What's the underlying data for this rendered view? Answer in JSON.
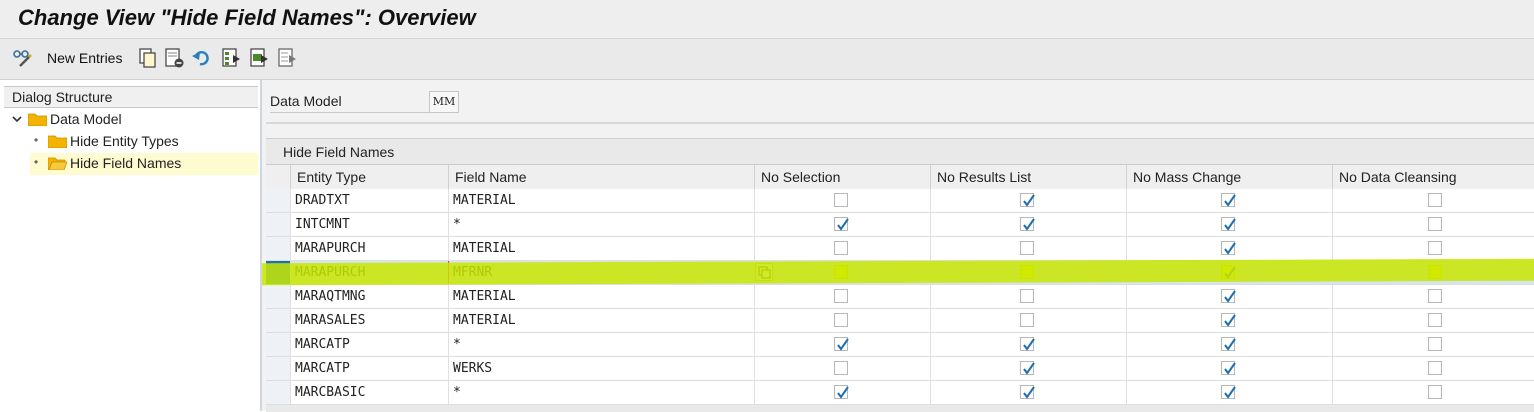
{
  "title": "Change View \"Hide Field Names\": Overview",
  "toolbar": {
    "new_entries_label": "New Entries",
    "icons": [
      "glasses-pencil-icon",
      "copy-icon",
      "delete-icon",
      "undo-icon",
      "select-all-icon",
      "select-block-icon",
      "deselect-all-icon"
    ]
  },
  "dialog": {
    "title": "Dialog Structure",
    "items": [
      {
        "label": "Data Model",
        "level": 0,
        "expanded": true
      },
      {
        "label": "Hide Entity Types",
        "level": 1
      },
      {
        "label": "Hide Field Names",
        "level": 1,
        "selected": true
      }
    ]
  },
  "header_field": {
    "label": "Data Model",
    "value": "MM"
  },
  "table": {
    "title": "Hide Field Names",
    "columns": [
      "Entity Type",
      "Field Name",
      "No Selection",
      "No Results List",
      "No Mass Change",
      "No Data Cleansing"
    ],
    "rows": [
      {
        "entity": "DRADTXT",
        "field": "MATERIAL",
        "checks": [
          false,
          true,
          true,
          false
        ]
      },
      {
        "entity": "INTCMNT",
        "field": "*",
        "checks": [
          true,
          true,
          true,
          false
        ]
      },
      {
        "entity": "MARAPURCH",
        "field": "MATERIAL",
        "checks": [
          false,
          false,
          true,
          false
        ]
      },
      {
        "entity": "MARAPURCH",
        "field": "MFRNR",
        "checks": [
          false,
          false,
          true,
          false
        ],
        "selected": true
      },
      {
        "entity": "MARAQTMNG",
        "field": "MATERIAL",
        "checks": [
          false,
          false,
          true,
          false
        ]
      },
      {
        "entity": "MARASALES",
        "field": "MATERIAL",
        "checks": [
          false,
          false,
          true,
          false
        ]
      },
      {
        "entity": "MARCATP",
        "field": "*",
        "checks": [
          true,
          true,
          true,
          false
        ]
      },
      {
        "entity": "MARCATP",
        "field": "WERKS",
        "checks": [
          false,
          true,
          true,
          false
        ]
      },
      {
        "entity": "MARCBASIC",
        "field": "*",
        "checks": [
          true,
          true,
          true,
          false
        ]
      }
    ]
  },
  "colors": {
    "highlight": "#c9e600",
    "selected_row_marker": "#1a6fb5",
    "check": "#1f6fb2"
  }
}
